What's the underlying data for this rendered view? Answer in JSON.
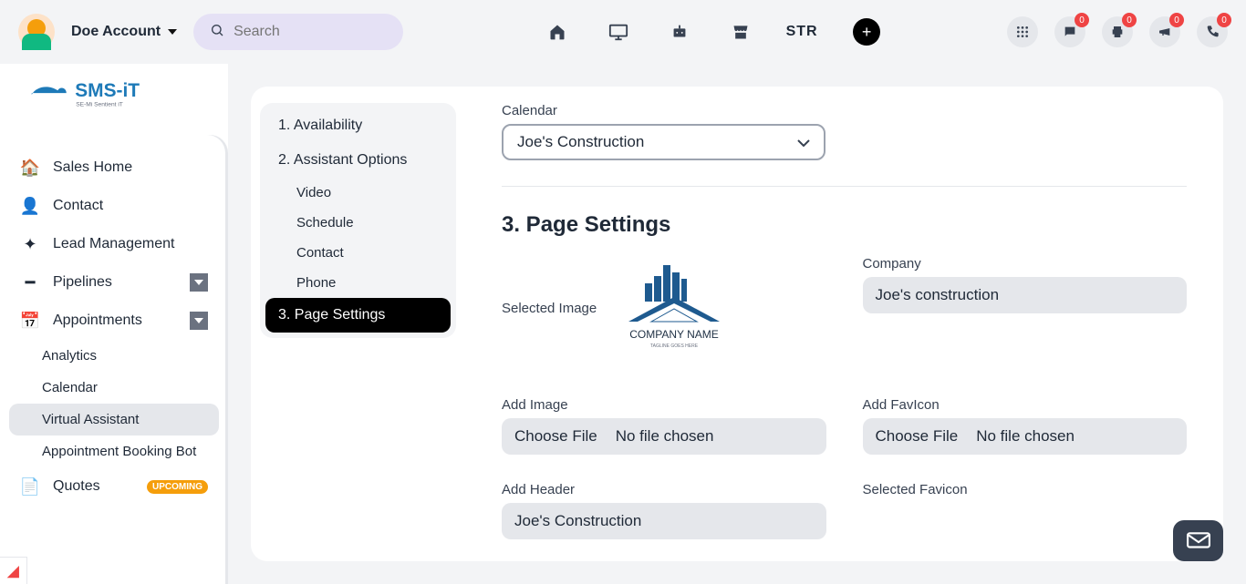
{
  "topbar": {
    "account": "Doe Account",
    "search_placeholder": "Search",
    "str": "STR",
    "badges": {
      "chat": "0",
      "print": "0",
      "announce": "0",
      "phone": "0"
    }
  },
  "sidebar": {
    "brand_main": "SMS-iT",
    "brand_sub": "SE-Mi Sentient iT",
    "items": [
      {
        "label": "Sales Home"
      },
      {
        "label": "Contact"
      },
      {
        "label": "Lead Management"
      },
      {
        "label": "Pipelines",
        "expandable": true
      },
      {
        "label": "Appointments",
        "expandable": true
      }
    ],
    "appointments_sub": [
      {
        "label": "Analytics"
      },
      {
        "label": "Calendar"
      },
      {
        "label": "Virtual Assistant",
        "active": true
      },
      {
        "label": "Appointment Booking Bot"
      }
    ],
    "quotes": {
      "label": "Quotes",
      "pill": "UPCOMING"
    }
  },
  "steps": {
    "s1": "1. Availability",
    "s2": "2. Assistant Options",
    "s2_sub": [
      "Video",
      "Schedule",
      "Contact",
      "Phone"
    ],
    "s3": "3. Page Settings"
  },
  "content": {
    "calendar_label": "Calendar",
    "calendar_value": "Joe's Construction",
    "section_title": "3. Page Settings",
    "selected_image_label": "Selected Image",
    "logo_line1": "COMPANY NAME",
    "logo_line2": "TAGLINE GOES HERE",
    "company_label": "Company",
    "company_value": "Joe's construction",
    "add_image_label": "Add Image",
    "add_favicon_label": "Add FavIcon",
    "choose_file": "Choose File",
    "no_file": "No file chosen",
    "add_header_label": "Add Header",
    "add_header_value": "Joe's Construction",
    "selected_favicon_label": "Selected Favicon"
  }
}
